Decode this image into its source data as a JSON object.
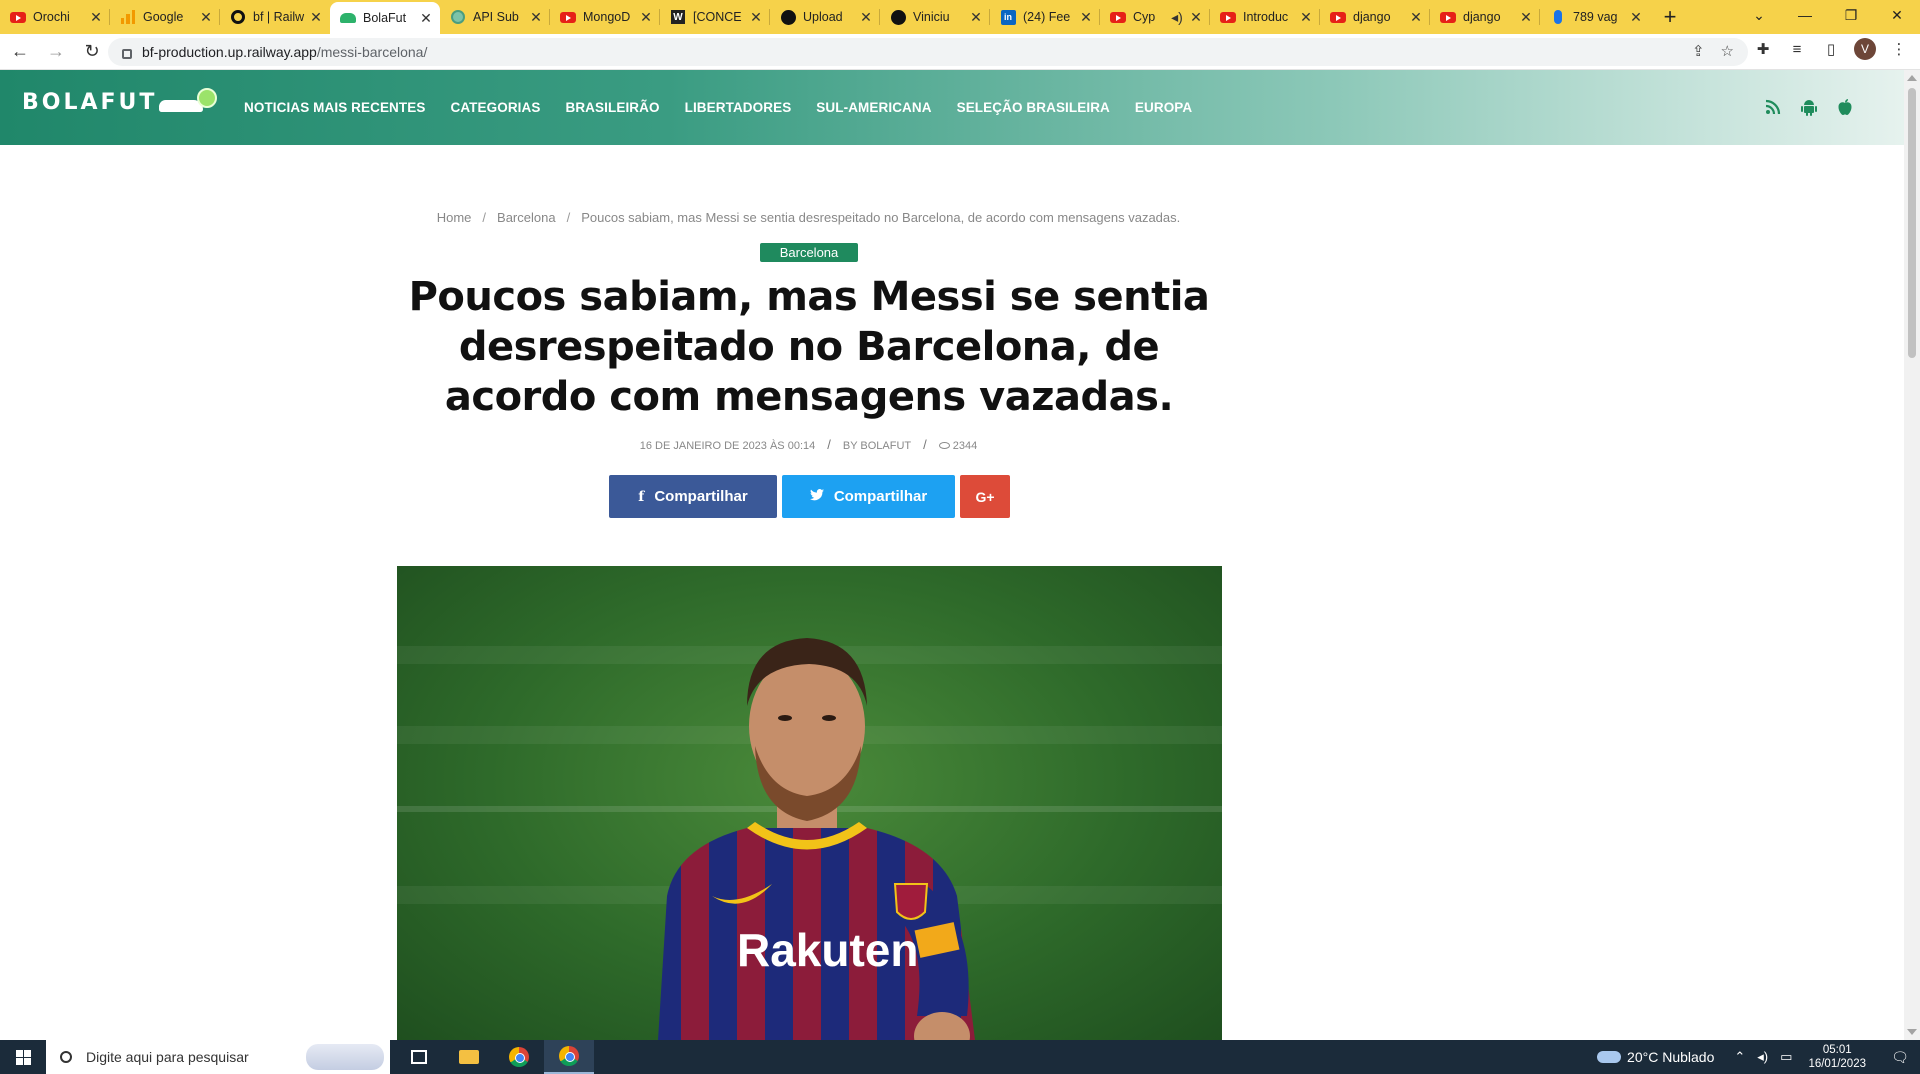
{
  "browser": {
    "tabs": [
      {
        "title": "Orochi",
        "icon": "youtube-icon",
        "active": false
      },
      {
        "title": "Google",
        "icon": "analytics-icon",
        "active": false
      },
      {
        "title": "bf | Railw",
        "icon": "railway-icon",
        "active": false
      },
      {
        "title": "BolaFut",
        "icon": "bolafut-icon",
        "active": true
      },
      {
        "title": "API Sub",
        "icon": "api-icon",
        "active": false
      },
      {
        "title": "MongoD",
        "icon": "youtube-icon",
        "active": false
      },
      {
        "title": "[CONCE",
        "icon": "w-icon",
        "active": false
      },
      {
        "title": "Upload",
        "icon": "github-icon",
        "active": false
      },
      {
        "title": "Viniciu",
        "icon": "github-icon",
        "active": false
      },
      {
        "title": "(24) Fee",
        "icon": "linkedin-icon",
        "active": false
      },
      {
        "title": "Cyp",
        "icon": "youtube-icon",
        "active": false
      },
      {
        "title": "Introduc",
        "icon": "youtube-icon",
        "active": false
      },
      {
        "title": "django",
        "icon": "youtube-icon",
        "active": false
      },
      {
        "title": "django",
        "icon": "youtube-icon",
        "active": false
      },
      {
        "title": "789 vag",
        "icon": "pin-icon",
        "active": false
      }
    ],
    "url_host": "bf-production.up.railway.app",
    "url_path": "/messi-barcelona/",
    "profile_initial": "V"
  },
  "site": {
    "logo": "BOLAFUT",
    "nav": [
      "NOTICIAS MAIS RECENTES",
      "CATEGORIAS",
      "BRASILEIRÃO",
      "LIBERTADORES",
      "SUL-AMERICANA",
      "SELEÇÃO BRASILEIRA",
      "EUROPA"
    ],
    "social_icons": [
      "rss-icon",
      "android-icon",
      "apple-icon"
    ],
    "accent_color": "#1f8a5e"
  },
  "article": {
    "breadcrumb": [
      "Home",
      "Barcelona",
      "Poucos sabiam, mas Messi se sentia desrespeitado no Barcelona, de acordo com mensagens vazadas."
    ],
    "category": "Barcelona",
    "title": "Poucos sabiam, mas Messi se sentia desrespeitado no Barcelona, de acordo com mensagens vazadas.",
    "date": "16 DE JANEIRO DE 2023 ÀS 00:14",
    "author": "BY BOLAFUT",
    "views": "2344",
    "share": {
      "facebook": "Compartilhar",
      "twitter": "Compartilhar",
      "google": "G+"
    },
    "image_text": {
      "sponsor": "Rakuten"
    }
  },
  "taskbar": {
    "search_placeholder": "Digite aqui para pesquisar",
    "weather": "20°C  Nublado",
    "time": "05:01",
    "date": "16/01/2023"
  }
}
